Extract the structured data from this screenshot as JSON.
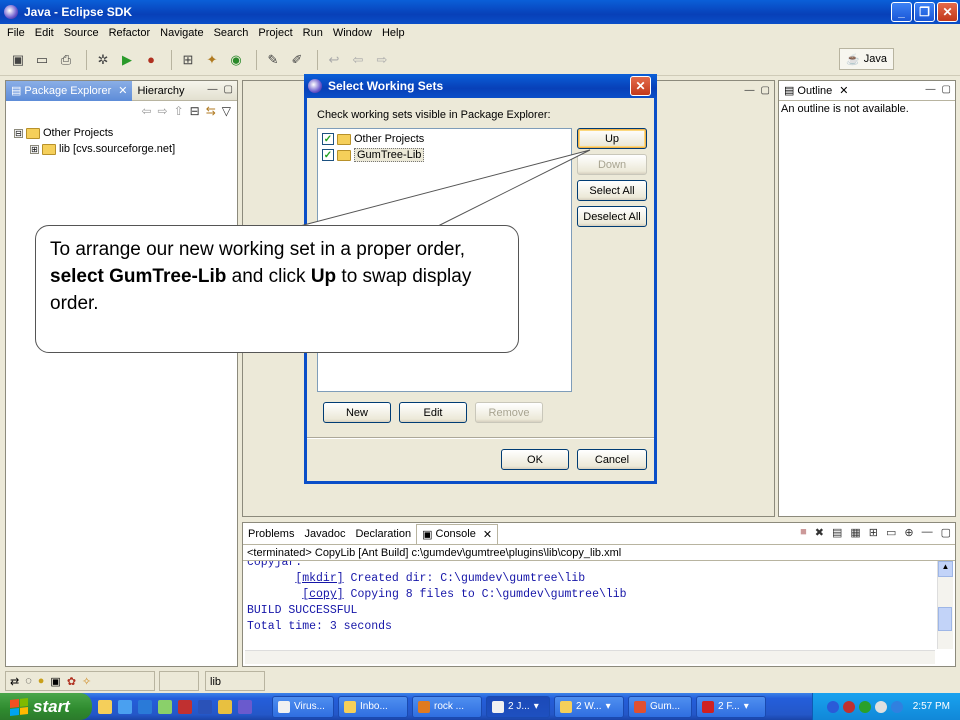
{
  "window": {
    "title": "Java - Eclipse SDK"
  },
  "menu": [
    "File",
    "Edit",
    "Source",
    "Refactor",
    "Navigate",
    "Search",
    "Project",
    "Run",
    "Window",
    "Help"
  ],
  "perspective": {
    "label": "Java"
  },
  "package_explorer": {
    "tabs": [
      "Package Explorer",
      "Hierarchy"
    ],
    "tree": [
      {
        "expander": "⊟",
        "label": "Other Projects"
      },
      {
        "expander": "⊞",
        "label": "lib",
        "sublabel": "[cvs.sourceforge.net]"
      }
    ]
  },
  "outline": {
    "tab": "Outline",
    "message": "An outline is not available."
  },
  "dialog": {
    "title": "Select Working Sets",
    "instruction": "Check working sets visible in Package Explorer:",
    "items": [
      {
        "label": "Other Projects",
        "checked": "✓"
      },
      {
        "label": "GumTree-Lib",
        "checked": "✓"
      }
    ],
    "buttons": {
      "up": "Up",
      "down": "Down",
      "select_all": "Select All",
      "deselect_all": "Deselect All",
      "new": "New",
      "edit": "Edit",
      "remove": "Remove",
      "ok": "OK",
      "cancel": "Cancel"
    }
  },
  "callout": {
    "text_1": "To arrange our new working set in a proper order, ",
    "bold_1": "select GumTree-Lib",
    "text_2": " and click ",
    "bold_2": "Up",
    "text_3": " to swap display order."
  },
  "bottom_panel": {
    "tabs": [
      "Problems",
      "Javadoc",
      "Declaration",
      "Console"
    ],
    "header": "<terminated> CopyLib [Ant Build] c:\\gumdev\\gumtree\\plugins\\lib\\copy_lib.xml",
    "lines": [
      {
        "prefix": "copyjar:",
        "link": "",
        "text": ""
      },
      {
        "prefix": "       ",
        "link": "[mkdir]",
        "text": " Created dir: C:\\gumdev\\gumtree\\lib"
      },
      {
        "prefix": "        ",
        "link": "[copy]",
        "text": " Copying 8 files to C:\\gumdev\\gumtree\\lib"
      },
      {
        "prefix": "BUILD SUCCESSFUL",
        "link": "",
        "text": ""
      },
      {
        "prefix": "Total time: 3 seconds",
        "link": "",
        "text": ""
      }
    ]
  },
  "status_bar": {
    "text": "lib"
  },
  "taskbar": {
    "start": "start",
    "tasks": [
      "Virus...",
      "Inbo...",
      "rock ...",
      "2 J...",
      "2 W...",
      "Gum...",
      "2 F..."
    ],
    "clock": "2:57 PM"
  },
  "colors": {
    "xp_blue": "#0a4ec8",
    "console_text": "#1616a8",
    "start_green": "#3c9a3c"
  }
}
